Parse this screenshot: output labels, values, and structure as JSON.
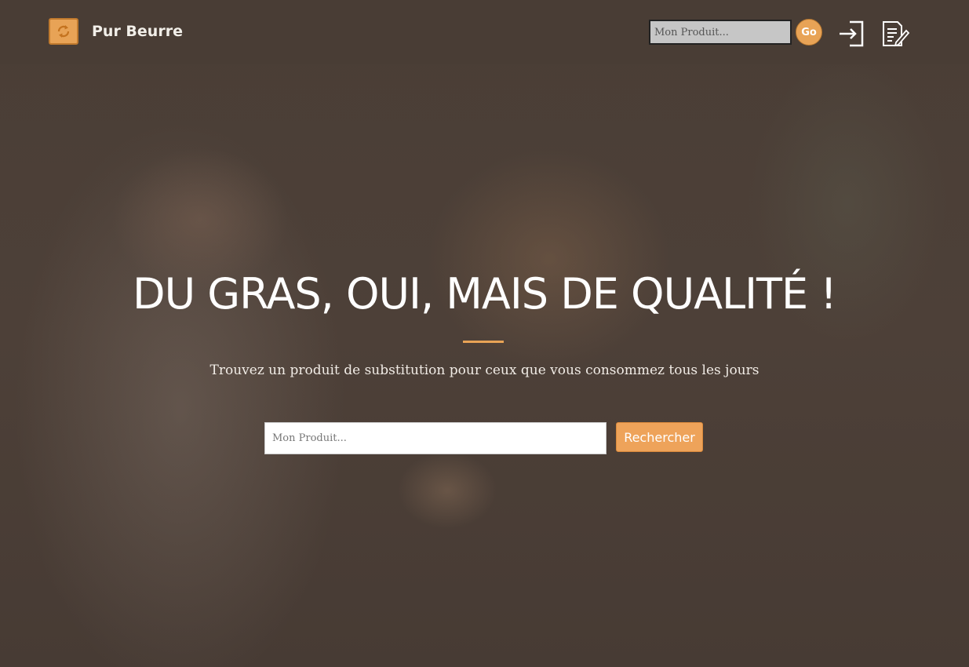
{
  "brand": {
    "name": "Pur Beurre",
    "logo_icon": "recycle-arrows-icon"
  },
  "nav": {
    "search_placeholder": "Mon Produit...",
    "go_label": "Go",
    "login_icon": "login-icon",
    "register_icon": "register-icon"
  },
  "hero": {
    "title": "DU GRAS, OUI, MAIS DE QUALITÉ !",
    "subtitle": "Trouvez un produit de substitution pour ceux que vous consommez tous les jours",
    "search_placeholder": "Mon Produit...",
    "search_button": "Rechercher"
  },
  "colors": {
    "accent": "#e8a356",
    "background": "#4b3f37",
    "text": "#ffffff"
  }
}
